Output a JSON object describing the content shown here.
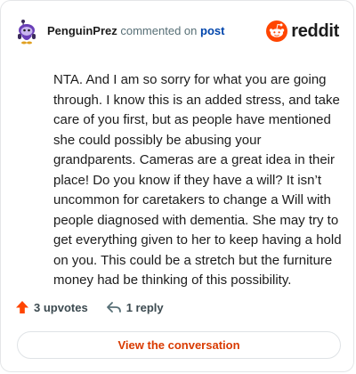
{
  "comment": {
    "author": "PenguinPrez",
    "action_text": "commented on",
    "post_link_text": "post",
    "body": "NTA. And I am so sorry for what you are going through. I know this is an added stress, and take care of you first, but as people have mentioned she could possibly be abusing your grandparents. Cameras are a great idea in their place! Do you know if they have a will? It isn’t uncommon for caretakers to change a Will with people diagnosed with dementia. She may try to get everything given to her to keep having a hold on you. This could be a stretch but the furniture money had be thinking of this possibility."
  },
  "brand": {
    "name": "reddit",
    "color": "#ff4500"
  },
  "footer": {
    "upvotes_label": "3 upvotes",
    "replies_label": "1 reply",
    "upvote_color": "#ff4500"
  },
  "cta": {
    "label": "View the conversation",
    "color": "#d93a00"
  },
  "icons": {
    "avatar": "penguin-snoo-avatar-icon",
    "logo": "reddit-snoo-icon",
    "upvote": "upvote-arrow-icon",
    "reply": "reply-arrow-icon"
  }
}
